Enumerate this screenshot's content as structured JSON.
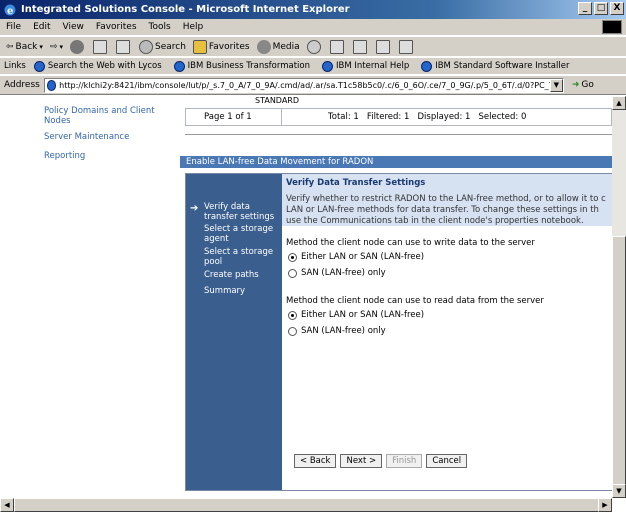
{
  "window": {
    "title": "Integrated Solutions Console - Microsoft Internet Explorer",
    "controls": [
      "_",
      "□",
      "X"
    ]
  },
  "menu": [
    "File",
    "Edit",
    "View",
    "Favorites",
    "Tools",
    "Help"
  ],
  "toolbar": {
    "back": "Back",
    "search": "Search",
    "favorites": "Favorites",
    "media": "Media"
  },
  "links": {
    "label": "Links",
    "items": [
      "Search the Web with Lycos",
      "IBM Business Transformation",
      "IBM Internal Help",
      "IBM Standard Software Installer"
    ]
  },
  "address": {
    "label": "Address",
    "url": "http://klchi2y:8421/ibm/console/lut/p/_s.7_0_A/7_0_9A/.cmd/ad/.ar/sa.T1c58b5c0/.c/6_0_6O/.ce/7_0_9G/.p/5_0_6T/.d/0?PC_7_0",
    "go": "Go"
  },
  "nav": {
    "policy": "Policy Domains and Client Nodes",
    "server_maint": "Server Maintenance",
    "reporting": "Reporting"
  },
  "table": {
    "standard": "STANDARD",
    "page": "Page 1 of 1",
    "status": "Total: 1   Filtered: 1   Displayed: 1   Selected: 0"
  },
  "section_title": "Enable LAN-free Data Movement for RADON",
  "wizard": {
    "steps": [
      "Verify data transfer settings",
      "Select a storage agent",
      "Select a storage pool",
      "Create paths",
      "Summary"
    ],
    "title": "Verify Data Transfer Settings",
    "description": [
      "Verify whether to restrict RADON to the LAN-free method, or to allow it to c",
      "LAN or LAN-free methods for data transfer. To change these settings in th",
      "use the Communications tab in the client node's properties notebook."
    ],
    "write_question": "Method the client node can use to write data to the server",
    "read_question": "Method the client node can use to read data from the server",
    "write_options": [
      "Either LAN or SAN (LAN-free)",
      "SAN (LAN-free) only"
    ],
    "read_options": [
      "Either LAN or SAN (LAN-free)",
      "SAN (LAN-free) only"
    ],
    "buttons": {
      "back": "< Back",
      "next": "Next >",
      "finish": "Finish",
      "cancel": "Cancel"
    }
  }
}
